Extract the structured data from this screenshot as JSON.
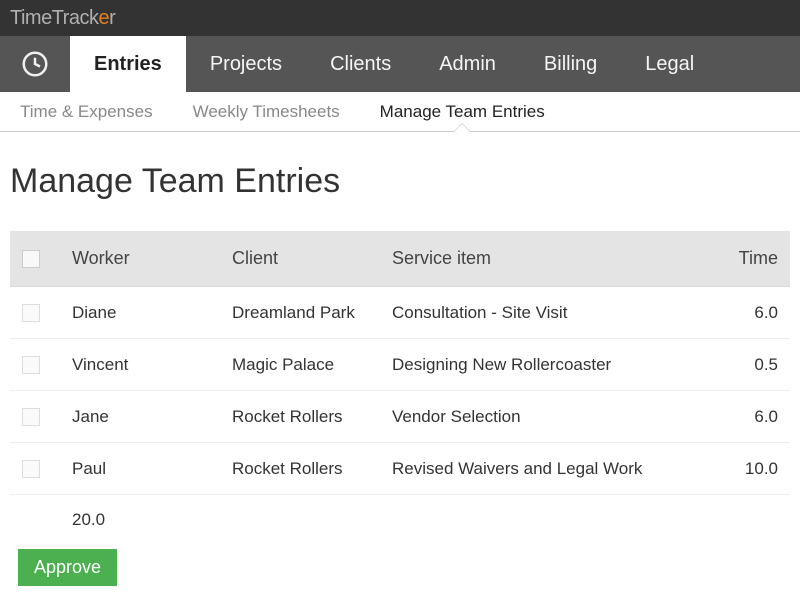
{
  "brand": {
    "pre": "TimeTrack",
    "accent": "e",
    "post": "r"
  },
  "nav": {
    "items": [
      {
        "label": "Entries",
        "active": true
      },
      {
        "label": "Projects",
        "active": false
      },
      {
        "label": "Clients",
        "active": false
      },
      {
        "label": "Admin",
        "active": false
      },
      {
        "label": "Billing",
        "active": false
      },
      {
        "label": "Legal",
        "active": false
      }
    ]
  },
  "subnav": {
    "items": [
      {
        "label": "Time & Expenses",
        "active": false
      },
      {
        "label": "Weekly Timesheets",
        "active": false
      },
      {
        "label": "Manage Team Entries",
        "active": true
      }
    ]
  },
  "page": {
    "title": "Manage Team Entries",
    "columns": {
      "worker": "Worker",
      "client": "Client",
      "service": "Service item",
      "time": "Time"
    },
    "rows": [
      {
        "worker": "Diane",
        "client": "Dreamland Park",
        "service": "Consultation - Site Visit",
        "time": "6.0"
      },
      {
        "worker": "Vincent",
        "client": "Magic Palace",
        "service": "Designing New Rollercoaster",
        "time": "0.5"
      },
      {
        "worker": "Jane",
        "client": "Rocket Rollers",
        "service": "Vendor Selection",
        "time": "6.0"
      },
      {
        "worker": "Paul",
        "client": "Rocket Rollers",
        "service": "Revised Waivers and Legal Work",
        "time": "10.0"
      }
    ],
    "total": "20.0",
    "approve_label": "Approve"
  }
}
